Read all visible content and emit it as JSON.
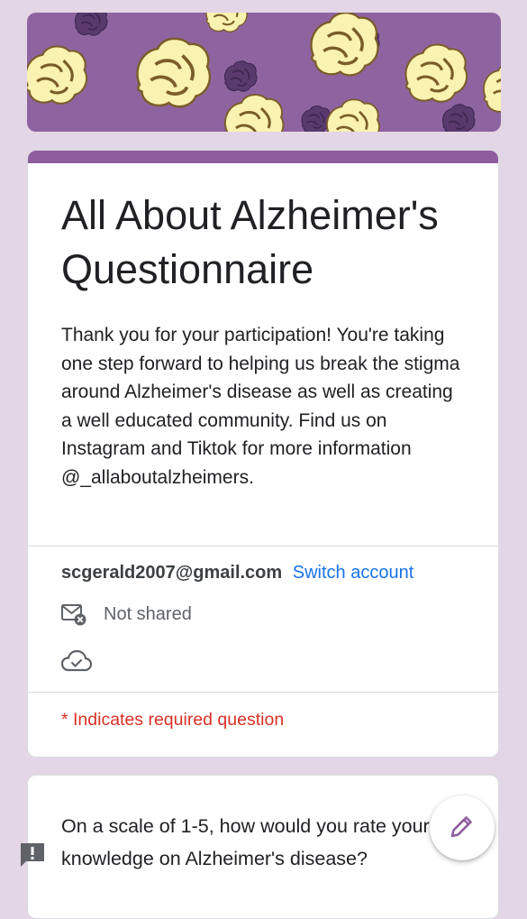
{
  "banner": {
    "icon": "brain-pattern",
    "colors": {
      "background": "#8e64a0",
      "brain_light": "#faf2b0",
      "brain_dark": "#5a3a6e"
    }
  },
  "form": {
    "title": "All About Alzheimer's Questionnaire",
    "description": "Thank you for your participation! You're taking one step forward to helping us break the stigma around Alzheimer's disease as well as creating a well educated community. Find us on Instagram and Tiktok for more information @_allaboutalzheimers.",
    "account_email": "scgerald2007@gmail.com",
    "switch_account_label": "Switch account",
    "not_shared_label": "Not shared",
    "required_note": "* Indicates required question",
    "accent_color": "#8e5d9e"
  },
  "question1": {
    "text": "On a scale of 1-5, how would you rate your knowledge on Alzheimer's disease?"
  },
  "fab": {
    "icon": "pencil-icon"
  },
  "feedback": {
    "icon": "report-icon"
  }
}
